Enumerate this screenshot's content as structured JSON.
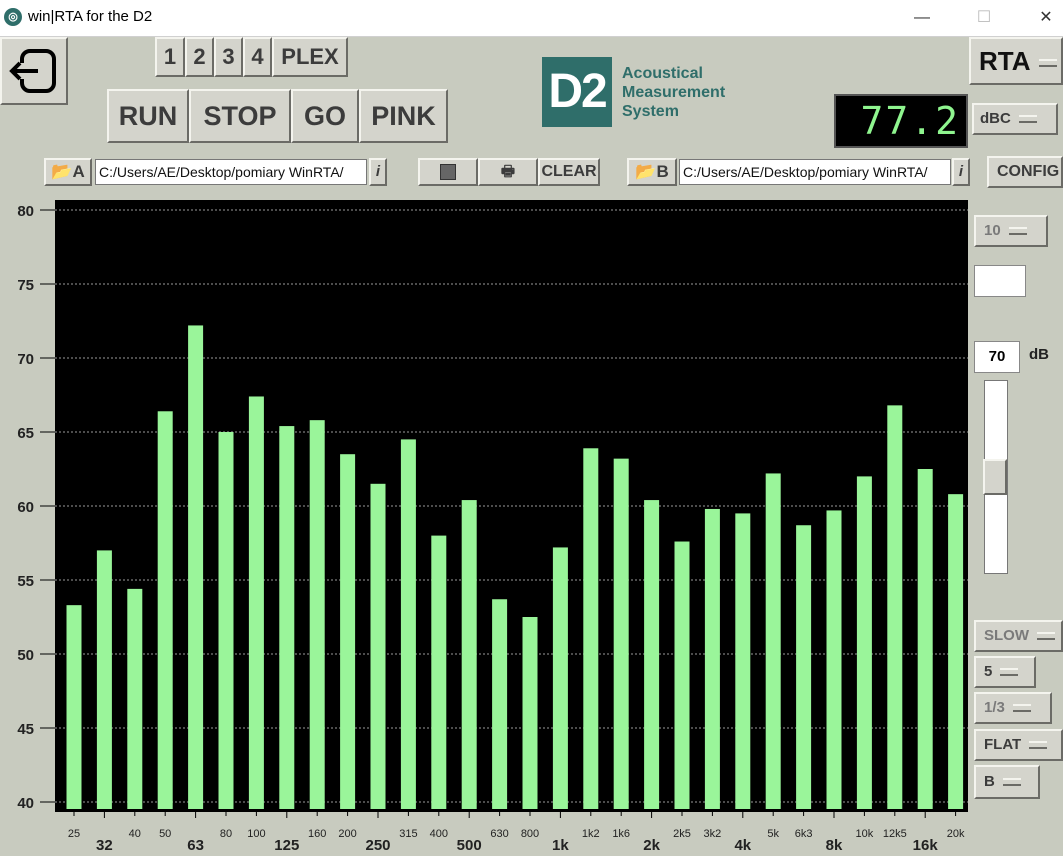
{
  "window": {
    "title": "win|RTA for the D2",
    "minimize": "—",
    "maximize": "☐",
    "close": "✕"
  },
  "toolbar": {
    "exit_icon": "exit-icon",
    "memory_buttons": [
      "1",
      "2",
      "3",
      "4",
      "PLEX"
    ],
    "run": "RUN",
    "stop": "STOP",
    "go": "GO",
    "pink": "PINK",
    "clear": "CLEAR"
  },
  "logo": {
    "mark": "D2",
    "line1": "Acoustical",
    "line2": "Measurement",
    "line3": "System",
    "color": "#2f6e6a"
  },
  "files": {
    "a_label": "A",
    "a_path": "C:/Users/AE/Desktop/pomiary WinRTA/",
    "b_label": "B",
    "b_path": "C:/Users/AE/Desktop/pomiary WinRTA/",
    "info": "i"
  },
  "right_panel": {
    "mode": "RTA",
    "level_display": "77.2",
    "weighting": "dBC",
    "config": "CONFIG >",
    "range": "10",
    "offset_value": "70",
    "offset_unit": "dB",
    "response": "SLOW",
    "average": "5",
    "bandwidth": "1/3",
    "filter": "FLAT",
    "channel": "B"
  },
  "chart_data": {
    "type": "bar",
    "ylim": [
      40,
      80
    ],
    "yticks": [
      "40",
      "45",
      "50",
      "55",
      "60",
      "65",
      "70",
      "75",
      "80"
    ],
    "bar_color": "#9af59a",
    "categories": [
      "25",
      "32",
      "40",
      "50",
      "63",
      "80",
      "100",
      "125",
      "160",
      "200",
      "250",
      "315",
      "400",
      "500",
      "630",
      "800",
      "1k",
      "1k2",
      "1k6",
      "2k",
      "2k5",
      "3k2",
      "4k",
      "5k",
      "6k3",
      "8k",
      "10k",
      "12k5",
      "16k",
      "20k"
    ],
    "major": [
      false,
      true,
      false,
      false,
      true,
      false,
      false,
      true,
      false,
      false,
      true,
      false,
      false,
      true,
      false,
      false,
      true,
      false,
      false,
      true,
      false,
      false,
      true,
      false,
      false,
      true,
      false,
      false,
      true,
      false
    ],
    "values": [
      53.3,
      57.0,
      54.4,
      66.4,
      72.2,
      65.0,
      67.4,
      65.4,
      65.8,
      63.5,
      61.5,
      64.5,
      58.0,
      60.4,
      53.7,
      52.5,
      57.2,
      63.9,
      63.2,
      60.4,
      57.6,
      59.8,
      59.5,
      62.2,
      58.7,
      59.7,
      62.0,
      66.8,
      62.5,
      60.8
    ]
  }
}
